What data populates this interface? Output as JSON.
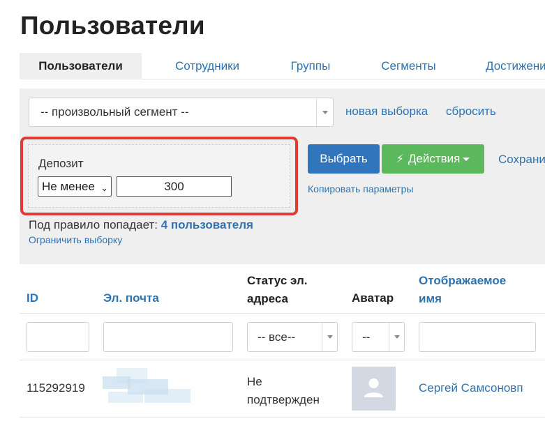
{
  "page": {
    "title": "Пользователи"
  },
  "tabs": [
    {
      "label": "Пользователи",
      "active": true
    },
    {
      "label": "Сотрудники",
      "active": false
    },
    {
      "label": "Группы",
      "active": false
    },
    {
      "label": "Сегменты",
      "active": false
    },
    {
      "label": "Достижения",
      "active": false
    }
  ],
  "segment": {
    "selected": "-- произвольный сегмент --",
    "new_selection_link": "новая выборка",
    "reset_link": "сбросить"
  },
  "rule": {
    "field_label": "Депозит",
    "operator": "Не менее",
    "value": "300",
    "highlight_color": "#e23a33"
  },
  "actions": {
    "select_button": "Выбрать",
    "actions_button": "Действия",
    "actions_icon": "lightning-icon",
    "save_link": "Сохранить",
    "copy_params_link": "Копировать параметры"
  },
  "match": {
    "prefix": "Под правило попадает:",
    "count_text": "4 пользователя",
    "limit_link": "Ограничить выборку"
  },
  "table": {
    "columns": [
      {
        "key": "id",
        "label": "ID",
        "sortable": true
      },
      {
        "key": "email",
        "label": "Эл. почта",
        "sortable": true
      },
      {
        "key": "email_status",
        "label_line1": "Статус эл.",
        "label_line2": "адреса",
        "sortable": false
      },
      {
        "key": "avatar",
        "label": "Аватар",
        "sortable": false
      },
      {
        "key": "display_name",
        "label_line1": "Отображаемое",
        "label_line2": "имя",
        "sortable": true
      }
    ],
    "filters": {
      "id": "",
      "email": "",
      "email_status": "-- все--",
      "avatar": "--",
      "display_name": ""
    },
    "rows": [
      {
        "id": "115292919",
        "email": "",
        "email_status_line1": "Не",
        "email_status_line2": "подтвержден",
        "avatar": "avatar-placeholder-icon",
        "display_name": "Сергей Самсоновп"
      }
    ]
  },
  "colors": {
    "link": "#2e73b0",
    "primary": "#3176bd",
    "success": "#5cb85c",
    "panel_bg": "#efefef"
  }
}
